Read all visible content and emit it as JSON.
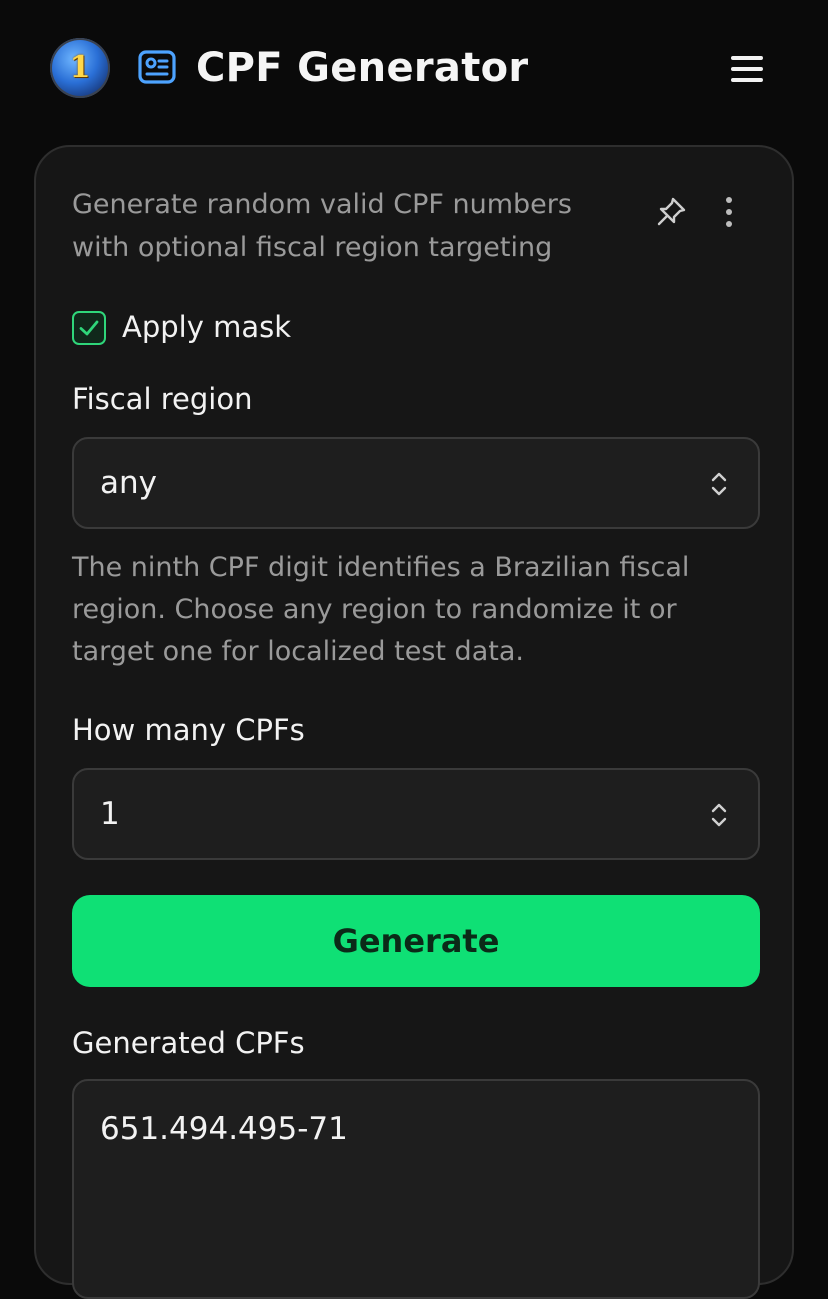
{
  "header": {
    "logo_text": "1",
    "title": "CPF Generator",
    "app_icon": "id-card-icon",
    "menu_icon": "hamburger-menu-icon"
  },
  "card": {
    "description": "Generate random valid CPF numbers with optional fiscal region targeting",
    "pin_icon": "pin-icon",
    "more_icon": "more-vertical-icon",
    "apply_mask": {
      "label": "Apply mask",
      "checked": true
    },
    "fiscal_region": {
      "label": "Fiscal region",
      "value": "any",
      "hint": "The ninth CPF digit identifies a Brazilian fiscal region. Choose any region to randomize it or target one for localized test data."
    },
    "count": {
      "label": "How many CPFs",
      "value": "1"
    },
    "generate_label": "Generate",
    "output": {
      "label": "Generated CPFs",
      "value": "651.494.495-71"
    }
  },
  "colors": {
    "accent": "#0fe075",
    "checkbox_border": "#2fd67a",
    "app_icon_blue": "#4da3ff",
    "background": "#0a0a0a",
    "card": "#161616"
  }
}
